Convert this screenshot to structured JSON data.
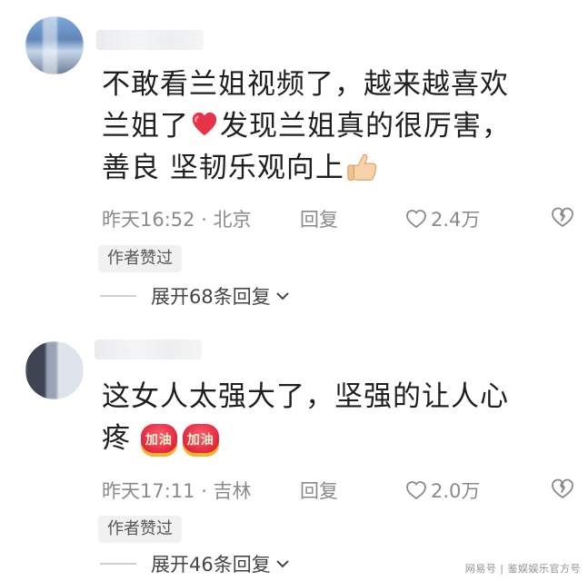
{
  "comments": [
    {
      "text_line1": "不敢看兰姐视频了，越来越喜欢",
      "text_line2_a": "兰姐了",
      "text_line2_b": "发现兰姐真的很厉害，",
      "text_line3": "善良 坚韧乐观向上",
      "time_location": "昨天16:52 · 北京",
      "reply_label": "回复",
      "like_count": "2.4万",
      "author_badge": "作者赞过",
      "expand_label": "展开68条回复"
    },
    {
      "text_line1": "这女人太强大了，坚强的让人心",
      "text_line2": "疼",
      "emoji_label": "加油",
      "time_location": "昨天17:11 · 吉林",
      "reply_label": "回复",
      "like_count": "2.0万",
      "author_badge": "作者赞过",
      "expand_label": "展开46条回复"
    }
  ],
  "watermark": "网易号 | 鉴娱娱乐官方号",
  "icons": [
    "heart-emoji-icon",
    "thumbs-up-emoji-icon",
    "jiayou-emoji-icon",
    "like-heart-icon",
    "broken-heart-icon",
    "chevron-down-icon"
  ]
}
